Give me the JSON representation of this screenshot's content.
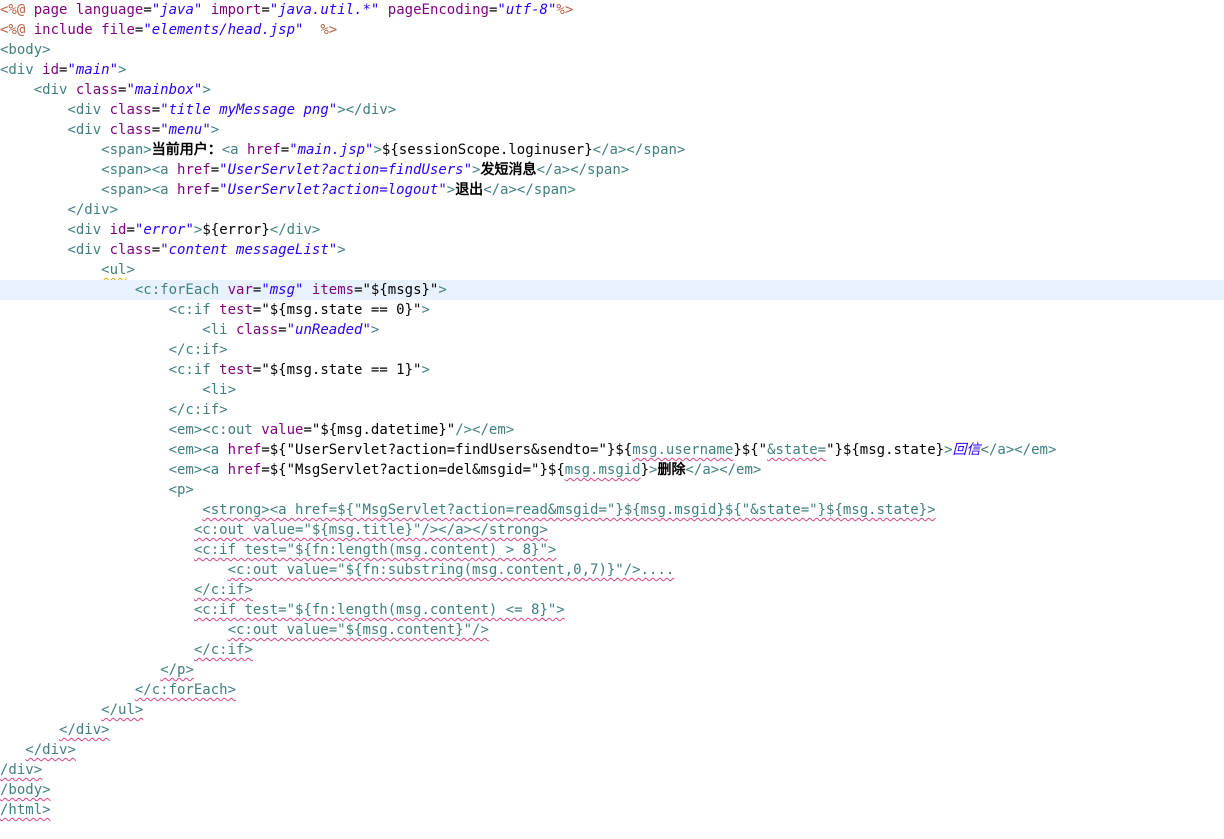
{
  "editor": {
    "language": "JSP",
    "current_line": 14,
    "lines": [
      {
        "indent": "",
        "tokens": [
          [
            "d",
            "<%@ "
          ],
          [
            "a",
            "page "
          ],
          [
            "a",
            "language"
          ],
          [
            "t",
            "="
          ],
          [
            "v",
            "\"java\""
          ],
          [
            "t",
            " "
          ],
          [
            "a",
            "import"
          ],
          [
            "t",
            "="
          ],
          [
            "v",
            "\"java.util.*\""
          ],
          [
            "t",
            " "
          ],
          [
            "a",
            "pageEncoding"
          ],
          [
            "t",
            "="
          ],
          [
            "v",
            "\"utf-8\""
          ],
          [
            "d",
            "%>"
          ]
        ]
      },
      {
        "indent": "",
        "tokens": [
          [
            "d",
            "<%@ "
          ],
          [
            "a",
            "include "
          ],
          [
            "a",
            "file"
          ],
          [
            "t",
            "="
          ],
          [
            "v",
            "\"elements/head.jsp\""
          ],
          [
            "t",
            "  "
          ],
          [
            "d",
            "%>"
          ]
        ]
      },
      {
        "indent": "",
        "tokens": [
          [
            "g",
            "<body>"
          ]
        ]
      },
      {
        "indent": "",
        "tokens": [
          [
            "g",
            "<div "
          ],
          [
            "a",
            "id"
          ],
          [
            "t",
            "="
          ],
          [
            "v",
            "\"main\""
          ],
          [
            "g",
            ">"
          ]
        ]
      },
      {
        "indent": "    ",
        "tokens": [
          [
            "g",
            "<div "
          ],
          [
            "a",
            "class"
          ],
          [
            "t",
            "="
          ],
          [
            "v",
            "\"mainbox\""
          ],
          [
            "g",
            ">"
          ]
        ]
      },
      {
        "indent": "        ",
        "tokens": [
          [
            "g",
            "<div "
          ],
          [
            "a",
            "class"
          ],
          [
            "t",
            "="
          ],
          [
            "v",
            "\"title myMessage png\""
          ],
          [
            "g",
            "></div>"
          ]
        ]
      },
      {
        "indent": "        ",
        "tokens": [
          [
            "g",
            "<div "
          ],
          [
            "a",
            "class"
          ],
          [
            "t",
            "="
          ],
          [
            "v",
            "\"menu\""
          ],
          [
            "g",
            ">"
          ]
        ]
      },
      {
        "indent": "            ",
        "tokens": [
          [
            "g",
            "<span>"
          ],
          [
            "c",
            "当前用户："
          ],
          [
            "g",
            "<a "
          ],
          [
            "a",
            "href"
          ],
          [
            "t",
            "="
          ],
          [
            "v",
            "\"main.jsp\""
          ],
          [
            "g",
            ">"
          ],
          [
            "t",
            "${sessionScope.loginuser}"
          ],
          [
            "g",
            "</a></span>"
          ]
        ]
      },
      {
        "indent": "            ",
        "tokens": [
          [
            "g",
            "<span><a "
          ],
          [
            "a",
            "href"
          ],
          [
            "t",
            "="
          ],
          [
            "v",
            "\"UserServlet?action=findUsers\""
          ],
          [
            "g",
            ">"
          ],
          [
            "c",
            "发短消息"
          ],
          [
            "g",
            "</a></span>"
          ]
        ]
      },
      {
        "indent": "            ",
        "tokens": [
          [
            "g",
            "<span><a "
          ],
          [
            "a",
            "href"
          ],
          [
            "t",
            "="
          ],
          [
            "v",
            "\"UserServlet?action=logout\""
          ],
          [
            "g",
            ">"
          ],
          [
            "c",
            "退出"
          ],
          [
            "g",
            "</a></span>"
          ]
        ]
      },
      {
        "indent": "        ",
        "tokens": [
          [
            "g",
            "</div>"
          ]
        ]
      },
      {
        "indent": "        ",
        "tokens": [
          [
            "g",
            "<div "
          ],
          [
            "a",
            "id"
          ],
          [
            "t",
            "="
          ],
          [
            "v",
            "\"error\""
          ],
          [
            "g",
            ">"
          ],
          [
            "t",
            "${error}"
          ],
          [
            "g",
            "</div>"
          ]
        ]
      },
      {
        "indent": "        ",
        "tokens": [
          [
            "g",
            "<div "
          ],
          [
            "a",
            "class"
          ],
          [
            "t",
            "="
          ],
          [
            "v",
            "\"content messageList\""
          ],
          [
            "g",
            ">"
          ]
        ]
      },
      {
        "indent": "            ",
        "tokens": [
          [
            "gy",
            "<ul"
          ],
          [
            "g",
            ">"
          ]
        ]
      },
      {
        "indent": "                ",
        "tokens": [
          [
            "g",
            "<c:forEach "
          ],
          [
            "a",
            "var"
          ],
          [
            "t",
            "="
          ],
          [
            "v",
            "\"msg\""
          ],
          [
            "t",
            " "
          ],
          [
            "a",
            "items"
          ],
          [
            "t",
            "="
          ],
          [
            "t",
            "\"${msgs}\""
          ],
          [
            "g",
            ">"
          ]
        ]
      },
      {
        "indent": "                    ",
        "tokens": [
          [
            "g",
            "<c:if "
          ],
          [
            "a",
            "test"
          ],
          [
            "t",
            "="
          ],
          [
            "t",
            "\"${msg.state == 0}\""
          ],
          [
            "g",
            ">"
          ]
        ]
      },
      {
        "indent": "                        ",
        "tokens": [
          [
            "g",
            "<li "
          ],
          [
            "a",
            "class"
          ],
          [
            "t",
            "="
          ],
          [
            "v",
            "\"unReaded\""
          ],
          [
            "g",
            ">"
          ]
        ]
      },
      {
        "indent": "                    ",
        "tokens": [
          [
            "g",
            "</c:if>"
          ]
        ]
      },
      {
        "indent": "                    ",
        "tokens": [
          [
            "g",
            "<c:if "
          ],
          [
            "a",
            "test"
          ],
          [
            "t",
            "="
          ],
          [
            "t",
            "\"${msg.state == 1}\""
          ],
          [
            "g",
            ">"
          ]
        ]
      },
      {
        "indent": "                        ",
        "tokens": [
          [
            "g",
            "<li>"
          ]
        ]
      },
      {
        "indent": "                    ",
        "tokens": [
          [
            "g",
            "</c:if>"
          ]
        ]
      },
      {
        "indent": "                    ",
        "tokens": [
          [
            "g",
            "<em><c:out "
          ],
          [
            "a",
            "value"
          ],
          [
            "t",
            "="
          ],
          [
            "t",
            "\"${msg.datetime}\""
          ],
          [
            "g",
            "/></em>"
          ]
        ]
      },
      {
        "indent": "                    ",
        "tokens": [
          [
            "g",
            "<em><a "
          ],
          [
            "a",
            "href"
          ],
          [
            "t",
            "=${\"UserServlet?action=findUsers&sendto=\"}${"
          ],
          [
            "sq",
            "msg.username"
          ],
          [
            "t",
            "}${\""
          ],
          [
            "sq",
            "&state="
          ],
          [
            "t",
            "\"}${msg.state}"
          ],
          [
            "g",
            ">"
          ],
          [
            "cv",
            "回信"
          ],
          [
            "g",
            "</a></em>"
          ]
        ]
      },
      {
        "indent": "                    ",
        "tokens": [
          [
            "g",
            "<em><a "
          ],
          [
            "a",
            "href"
          ],
          [
            "t",
            "=${\"MsgServlet?action=del&msgid=\"}${"
          ],
          [
            "sq",
            "msg.msgid"
          ],
          [
            "t",
            "}"
          ],
          [
            "g",
            ">"
          ],
          [
            "c",
            "删除"
          ],
          [
            "g",
            "</a></em>"
          ]
        ]
      },
      {
        "indent": "                    ",
        "tokens": [
          [
            "g",
            "<p>"
          ]
        ]
      },
      {
        "indent": "                        ",
        "tokens": [
          [
            "sq",
            "<strong><a href=${\"MsgServlet?action=read&msgid=\"}${msg.msgid}${\"&state=\"}${msg.state}>"
          ]
        ]
      },
      {
        "indent": "                       ",
        "tokens": [
          [
            "sq",
            "<c:out value=\"${msg.title}\"/></a></strong>"
          ]
        ]
      },
      {
        "indent": "                       ",
        "tokens": [
          [
            "sq",
            "<c:if test=\"${fn:length(msg.content) > 8}\">"
          ]
        ]
      },
      {
        "indent": "                           ",
        "tokens": [
          [
            "sq",
            "<c:out value=\"${fn:substring(msg.content,0,7)}\"/>...."
          ]
        ]
      },
      {
        "indent": "                       ",
        "tokens": [
          [
            "sq",
            "</c:if>"
          ]
        ]
      },
      {
        "indent": "                       ",
        "tokens": [
          [
            "sq",
            "<c:if test=\"${fn:length(msg.content) <= 8}\">"
          ]
        ]
      },
      {
        "indent": "                           ",
        "tokens": [
          [
            "sq",
            "<c:out value=\"${msg.content}\"/>"
          ]
        ]
      },
      {
        "indent": "                       ",
        "tokens": [
          [
            "sq",
            "</c:if>"
          ]
        ]
      },
      {
        "indent": "                   ",
        "tokens": [
          [
            "sq",
            "</p>"
          ]
        ]
      },
      {
        "indent": "                ",
        "tokens": [
          [
            "sq",
            "</c:forEach>"
          ]
        ]
      },
      {
        "indent": "            ",
        "tokens": [
          [
            "sq",
            "</ul>"
          ]
        ]
      },
      {
        "indent": "       ",
        "tokens": [
          [
            "sq",
            "</div>"
          ]
        ]
      },
      {
        "indent": "   ",
        "tokens": [
          [
            "sq",
            "</div>"
          ]
        ]
      },
      {
        "indent": "",
        "tokens": [
          [
            "sq",
            "/div>"
          ]
        ]
      },
      {
        "indent": "",
        "tokens": [
          [
            "sq",
            "/body>"
          ]
        ]
      },
      {
        "indent": "",
        "tokens": [
          [
            "sq",
            "/html>"
          ]
        ]
      }
    ]
  }
}
